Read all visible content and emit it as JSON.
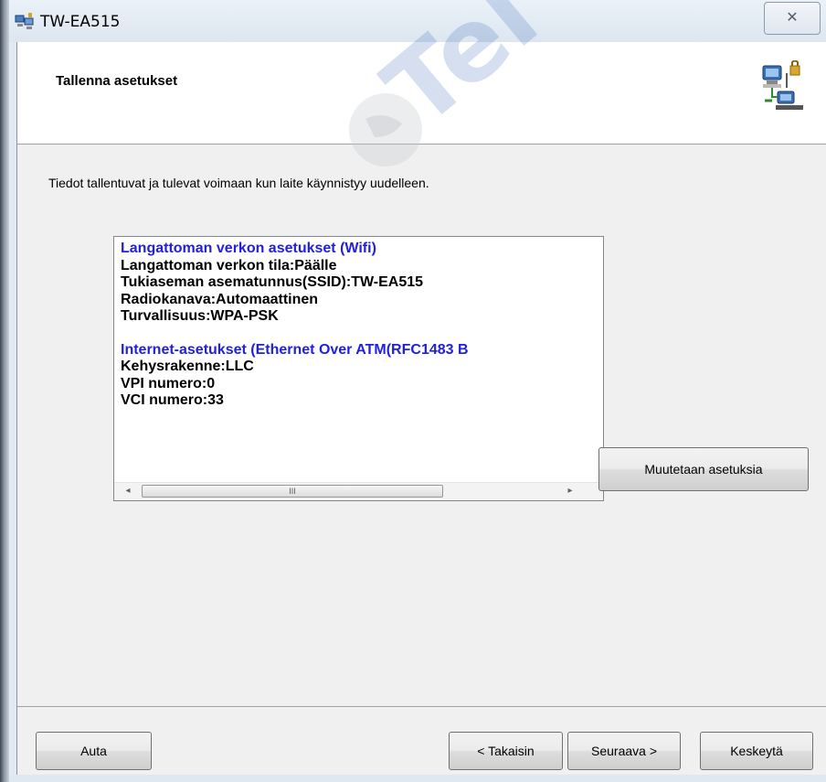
{
  "window": {
    "title": "TW-EA515",
    "close_glyph": "✕"
  },
  "header": {
    "title": "Tallenna asetukset",
    "icon": "network-computers-icon"
  },
  "info_text": "Tiedot tallentuvat ja tulevat voimaan kun laite käynnistyy uudelleen.",
  "summary": {
    "wifi_section": {
      "heading": "Langattoman verkon asetukset (Wifi)",
      "lines": [
        "Langattoman verkon tila:Päälle",
        "Tukiaseman asematunnus(SSID):TW-EA515",
        "Radiokanava:Automaattinen",
        "Turvallisuus:WPA-PSK"
      ]
    },
    "internet_section": {
      "heading": "Internet-asetukset  (Ethernet Over ATM(RFC1483 B",
      "lines": [
        "Kehysrakenne:LLC",
        "VPI numero:0",
        "VCI numero:33"
      ]
    },
    "scroll_left": "◂",
    "scroll_right": "▸",
    "scroll_grip": "III",
    "heading_color": "#2020dd"
  },
  "buttons": {
    "change": "Muutetaan asetuksia",
    "help": "Auta",
    "back": "< Takaisin",
    "next": "Seuraava >",
    "cancel": "Keskeytä"
  }
}
